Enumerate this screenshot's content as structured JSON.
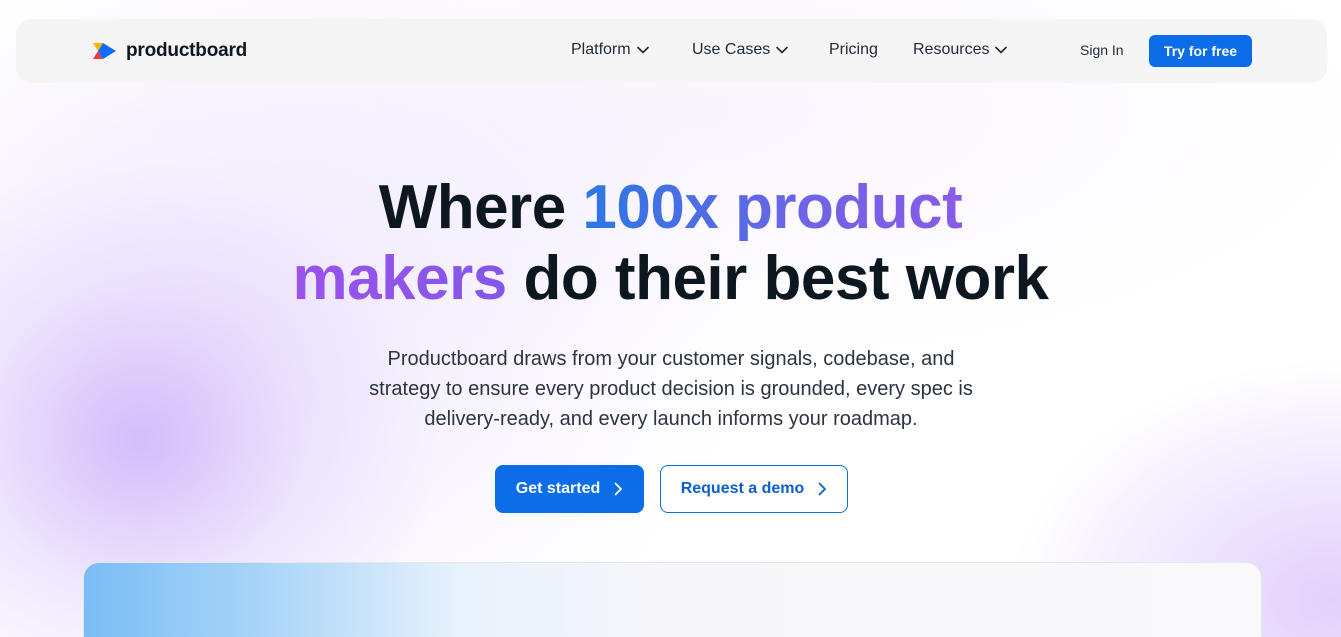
{
  "nav": {
    "logo_text": "productboard",
    "menu": [
      {
        "label": "Platform",
        "has_dropdown": true
      },
      {
        "label": "Use Cases",
        "has_dropdown": true
      },
      {
        "label": "Pricing",
        "has_dropdown": false
      },
      {
        "label": "Resources",
        "has_dropdown": true
      }
    ],
    "sign_in": "Sign In",
    "try_free": "Try for free"
  },
  "hero": {
    "headline_part1": "Where ",
    "headline_highlight1": "100x product",
    "headline_highlight2": "makers",
    "headline_part2": " do their best work",
    "subheadline": "Productboard draws from your customer signals, codebase, and strategy to ensure every product decision is grounded, every spec is delivery-ready, and every launch informs your roadmap.",
    "cta_primary": "Get started",
    "cta_secondary": "Request a demo"
  },
  "colors": {
    "brand_blue": "#0b6ee8",
    "text_dark": "#0d1720",
    "gradient_blue": "#2a78e4",
    "gradient_purple": "#9a52ea"
  },
  "icons": {
    "logo": "productboard-logo-icon",
    "dropdown": "chevron-down-icon",
    "cta_arrow": "chevron-right-icon"
  }
}
